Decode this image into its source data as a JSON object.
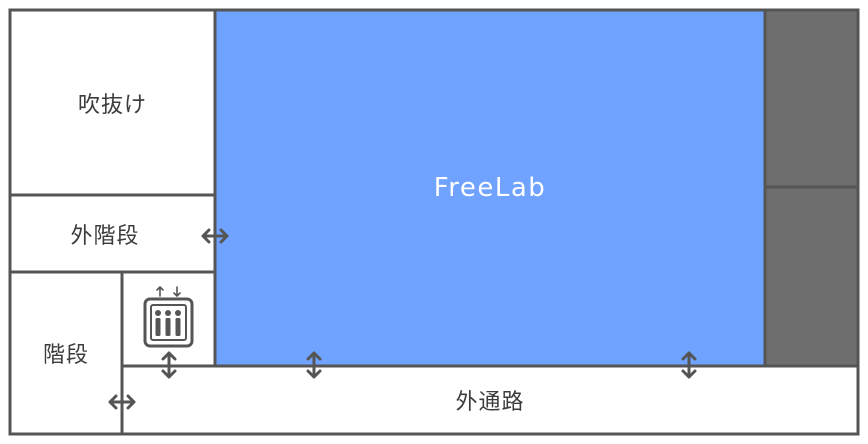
{
  "colors": {
    "line": "#555555",
    "freelab_fill": "#6fa3ff",
    "dark_fill": "#6e6e6e",
    "white_fill": "#ffffff"
  },
  "rooms": {
    "atrium": "吹抜け",
    "outer_stairs": "外階段",
    "stairs": "階段",
    "freelab": "FreeLab",
    "outer_passage": "外通路"
  },
  "icons": {
    "elevator": "elevator-icon",
    "arrow_horizontal": "double-arrow-horizontal-icon",
    "arrow_vertical": "double-arrow-vertical-icon"
  }
}
